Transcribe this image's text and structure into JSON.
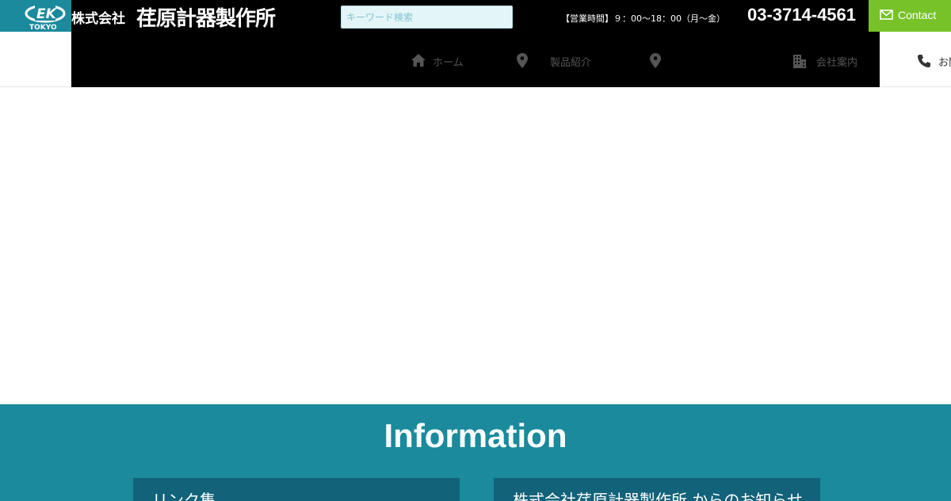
{
  "header": {
    "logo_lines": [
      "EK",
      "TOKYO"
    ],
    "company_prefix": "株式会社",
    "company_name": "荏原計器製作所",
    "search_placeholder": "キーワード検索",
    "hours": "【営業時間】９：00〜18：00（月〜金）",
    "phone": "03-3714-4561",
    "contact_label": "Contact"
  },
  "nav": {
    "items": [
      {
        "label": "ホーム",
        "icon": "home-icon"
      },
      {
        "label": "製品紹介",
        "icon": "map-pin-icon"
      },
      {
        "label": "",
        "icon": "map-pin-icon"
      },
      {
        "label": "会社案内",
        "icon": "building-icon"
      }
    ],
    "right_item": {
      "label": "お問",
      "icon": "phone-icon"
    }
  },
  "info": {
    "title": "Information",
    "boxes": [
      {
        "heading": "リンク集"
      },
      {
        "heading": "株式会社荏原計器製作所 からのお知らせ"
      }
    ]
  },
  "colors": {
    "teal": "#1a8a9c",
    "dark_teal": "#12627a",
    "green": "#77c229",
    "black": "#000000"
  }
}
